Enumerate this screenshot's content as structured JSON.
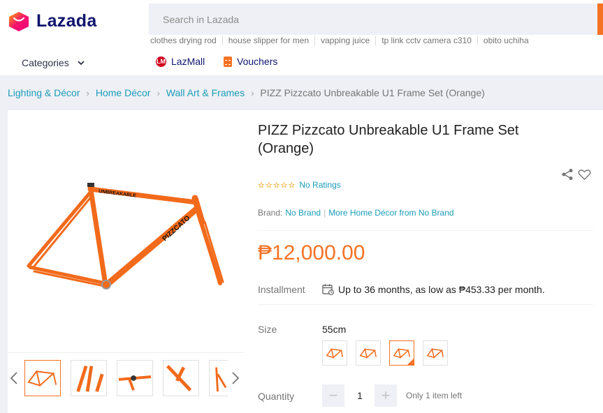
{
  "header": {
    "logo_text": "Lazada",
    "search": {
      "placeholder": "Search in Lazada"
    },
    "suggestions": [
      "clothes drying rod",
      "house slipper for men",
      "vapping juice",
      "tp link cctv camera c310",
      "obito uchiha"
    ],
    "categories_label": "Categories",
    "lazmall_label": "LazMall",
    "lazmall_icon_text": "LM",
    "vouchers_label": "Vouchers"
  },
  "breadcrumb": {
    "items": [
      "Lighting & Décor",
      "Home Décor",
      "Wall Art & Frames"
    ],
    "current": "PIZZ Pizzcato Unbreakable U1 Frame Set (Orange)",
    "separator": "›"
  },
  "product": {
    "title": "PIZZ Pizzcato Unbreakable U1 Frame Set (Orange)",
    "rating_text": "No Ratings",
    "brand_label": "Brand:",
    "brand_value": "No Brand",
    "brand_more": "More Home Décor from No Brand",
    "price": "₱12,000.00",
    "installment_label": "Installment",
    "installment_text": "Up to 36 months, as low as ₱453.33 per month.",
    "size_label": "Size",
    "size_value": "55cm",
    "quantity_label": "Quantity",
    "quantity_value": "1",
    "quantity_minus": "−",
    "quantity_plus": "+",
    "stock_note": "Only 1 item left",
    "frame_decal_top": "UNBREAKABLE",
    "frame_decal_down": "PIZZCATO"
  },
  "colors": {
    "accent": "#f57224",
    "link": "#1a9cb7",
    "brand_navy": "#0f146d",
    "frame_orange": "#f26a1b"
  },
  "icons": [
    "lazada-logo-icon",
    "chevron-down-icon",
    "lazmall-icon",
    "voucher-icon",
    "share-icon",
    "heart-icon",
    "calendar-icon",
    "chevron-left-icon",
    "chevron-right-icon",
    "star-icon"
  ]
}
